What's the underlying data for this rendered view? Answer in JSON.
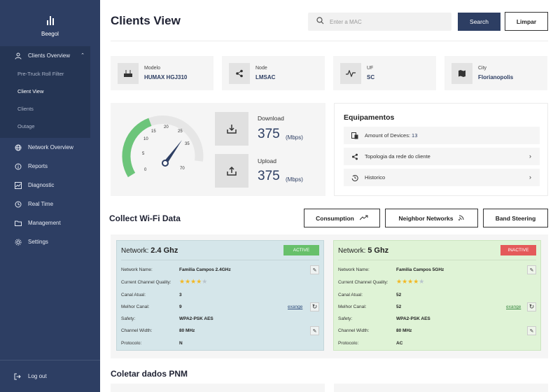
{
  "sidebar": {
    "brand": "Beegol",
    "items": [
      {
        "label": "Clients Overview",
        "icon": "user-icon"
      },
      {
        "label": "Network Overview",
        "icon": "globe-icon"
      },
      {
        "label": "Reports",
        "icon": "info-icon"
      },
      {
        "label": "Diagnostic",
        "icon": "chart-icon"
      },
      {
        "label": "Real Time",
        "icon": "clock-icon"
      },
      {
        "label": "Management",
        "icon": "folder-icon"
      },
      {
        "label": "Settings",
        "icon": "gear-icon"
      }
    ],
    "sub_items": [
      "Pre-Truck Roll Filter",
      "Client View",
      "Clients",
      "Outage"
    ],
    "active_sub": "Client View",
    "logout": "Log out"
  },
  "header": {
    "title": "Clients View",
    "search_placeholder": "Enter a MAC",
    "search_button": "Search",
    "clear_button": "Limpar"
  },
  "info_cards": [
    {
      "label": "Modelo",
      "value": "HUMAX HGJ310",
      "icon": "router-icon"
    },
    {
      "label": "Node",
      "value": "LMSAC",
      "icon": "share-icon"
    },
    {
      "label": "UF",
      "value": "SC",
      "icon": "pulse-icon"
    },
    {
      "label": "City",
      "value": "Florianopolis",
      "icon": "map-icon"
    }
  ],
  "speed": {
    "gauge_ticks": [
      "0",
      "5",
      "10",
      "15",
      "20",
      "25",
      "35",
      "70"
    ],
    "gauge_fill_fraction": 0.46,
    "download_label": "Download",
    "download_value": "375",
    "download_unit": "(Mbps)",
    "upload_label": "Upload",
    "upload_value": "375",
    "upload_unit": "(Mbps)",
    "accent": "#6cc57a"
  },
  "equipamentos": {
    "title": "Equipamentos",
    "devices_label": "Amount of Devices: ",
    "devices_count": "13",
    "topology": "Topologia da rede do cliente",
    "history": "Historico"
  },
  "wifi_section": {
    "title": "Collect Wi-Fi Data",
    "buttons": [
      "Consumption",
      "Neighbor Networks",
      "Band Steering"
    ]
  },
  "networks": [
    {
      "prefix": "Network: ",
      "band": "2.4 Ghz",
      "status": "ACTIVE",
      "status_color": "#67c06b",
      "labels": [
        "Network Name:",
        "Current Channel Quality:",
        "Canal Atual:",
        "Melhor Canal:",
        "Safety:",
        "Channel Width:",
        "Protocolo:"
      ],
      "values": {
        "name": "Familia Campos 2.4GHz",
        "canal_atual": "3",
        "melhor_canal": "9",
        "safety": "WPA2-PSK AES",
        "width": "80 MHz",
        "protocolo": "N"
      },
      "quality_stars": 4,
      "exange": "exange",
      "exange_color": "#2d4b7a"
    },
    {
      "prefix": "Network: ",
      "band": "5 Ghz",
      "status": "INACTIVE",
      "status_color": "#e45a5a",
      "labels": [
        "Network Name:",
        "Current Channel Quality:",
        "Canal Atual:",
        "Melhor Canal:",
        "Safety:",
        "Channel Width:",
        "Protocolo:"
      ],
      "values": {
        "name": "Familia Campos 5GHz",
        "canal_atual": "52",
        "melhor_canal": "52",
        "safety": "WPA2-PSK AES",
        "width": "80 MHz",
        "protocolo": "AC"
      },
      "quality_stars": 4,
      "exange": "exange",
      "exange_color": "#3c8a43"
    }
  ],
  "pnm": {
    "title": "Coletar dados PNM"
  }
}
